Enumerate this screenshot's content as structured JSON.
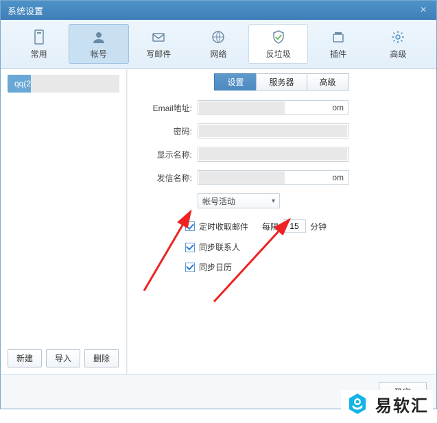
{
  "window": {
    "title": "系统设置",
    "close_glyph": "×"
  },
  "toolbar": {
    "items": [
      {
        "name": "common",
        "label": "常用"
      },
      {
        "name": "account",
        "label": "帐号"
      },
      {
        "name": "compose",
        "label": "写邮件"
      },
      {
        "name": "network",
        "label": "网络"
      },
      {
        "name": "antispam",
        "label": "反垃圾"
      },
      {
        "name": "plugins",
        "label": "插件"
      },
      {
        "name": "advanced",
        "label": "高级"
      }
    ]
  },
  "sidebar": {
    "account_prefix": "qq(2",
    "buttons": {
      "new": "新建",
      "import": "导入",
      "delete": "删除"
    }
  },
  "tabs": {
    "settings": "设置",
    "server": "服务器",
    "advanced": "高级"
  },
  "form": {
    "email_label": "Email地址:",
    "email_suffix": "om",
    "password_label": "密码:",
    "display_label": "显示名称:",
    "sender_label": "发信名称:",
    "sender_suffix": "om",
    "status_label": "帐号活动",
    "checks": {
      "schedule": "定时收取邮件",
      "every": "每隔",
      "interval": "15",
      "minutes": "分钟",
      "sync_contacts": "同步联系人",
      "sync_calendar": "同步日历"
    }
  },
  "footer": {
    "ok": "确定"
  },
  "brand": {
    "text": "易软汇"
  }
}
